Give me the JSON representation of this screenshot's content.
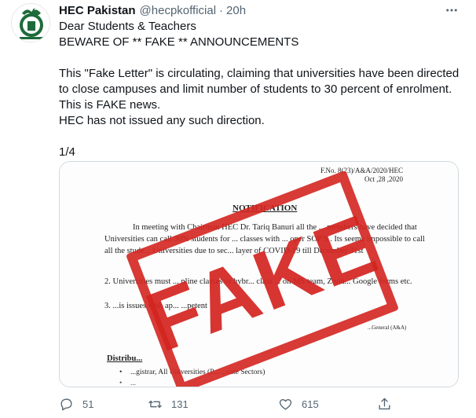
{
  "tweet": {
    "author": {
      "display_name": "HEC Pakistan",
      "handle": "@hecpkofficial",
      "avatar_icon": "hec-logo",
      "separator": "·",
      "time": "20h"
    },
    "more_icon": "more-icon",
    "text_lines": [
      "Dear Students & Teachers",
      "BEWARE OF ** FAKE ** ANNOUNCEMENTS",
      "",
      "This \"Fake Letter\" is circulating, claiming that universities have been directed",
      "to close campuses and limit number of students to 30 percent of enrolment.",
      "This is FAKE news.",
      "HEC has not issued any such direction.",
      "",
      "1/4"
    ],
    "media": {
      "ref_line1": "F.No. 8(23)/A&A/2020/HEC",
      "ref_line2": "Oct ,28 ,2020",
      "notification_title": "NOTIFICATION",
      "para1": "In meeting with Chairman HEC Dr. Tariq Banuri all the ... members have decided that Universities can call 30% students for ... classes with ... oper SOP'S . Its seems impossible to call all the stude... Universities due to sec... layer of COVID-19 till December 31st",
      "para2": "2.  Universities must ... nline classes or hybr... class ... on MS team, Zoon... Google forms etc.",
      "para3": "3.   ...is issues with ap... ...petent",
      "signature": "...General (A&A)",
      "distribution_heading": "Distribu...",
      "distribution_item1": "...gistrar, All Universities (P... ...vate Sectors)",
      "distribution_item2": "...",
      "stamp_text": "FAKE",
      "stamp_color": "#d42520"
    },
    "actions": {
      "reply": {
        "icon": "reply-icon",
        "count": "51"
      },
      "retweet": {
        "icon": "retweet-icon",
        "count": "131"
      },
      "like": {
        "icon": "heart-icon",
        "count": "615"
      },
      "share": {
        "icon": "share-icon"
      }
    }
  }
}
